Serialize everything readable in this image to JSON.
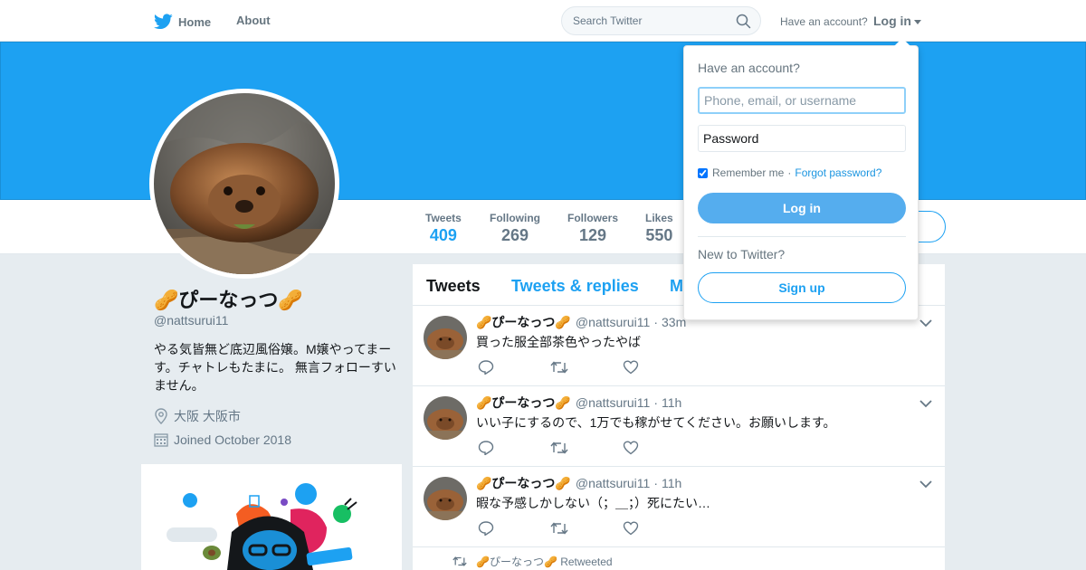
{
  "nav": {
    "home_label": "Home",
    "about_label": "About",
    "search_placeholder": "Search Twitter",
    "have_account": "Have an account?",
    "login_label": "Log in"
  },
  "stats": [
    {
      "label": "Tweets",
      "value": "409"
    },
    {
      "label": "Following",
      "value": "269"
    },
    {
      "label": "Followers",
      "value": "129"
    },
    {
      "label": "Likes",
      "value": "550"
    }
  ],
  "profile": {
    "name": "🥜ぴーなっつ🥜",
    "handle": "@nattsurui11",
    "bio": "やる気皆無ど底辺風俗嬢。M嬢やってまーす。チャトレもたまに。 無言フォローすいません。",
    "location": "大阪 大阪市",
    "joined": "Joined October 2018"
  },
  "timeline": {
    "tabs": [
      "Tweets",
      "Tweets & replies",
      "M"
    ],
    "tweets": [
      {
        "name": "🥜ぴーなっつ🥜",
        "handle": "@nattsurui11",
        "time": "33m",
        "text": "買った服全部茶色やったやば"
      },
      {
        "name": "🥜ぴーなっつ🥜",
        "handle": "@nattsurui11",
        "time": "11h",
        "text": "いい子にするので、1万でも稼がせてください。お願いします。"
      },
      {
        "name": "🥜ぴーなっつ🥜",
        "handle": "@nattsurui11",
        "time": "11h",
        "text": "暇な予感しかしない（；＿；）死にたい…"
      }
    ],
    "retweeted_note": "🥜ぴーなっつ🥜 Retweeted"
  },
  "login_dropdown": {
    "title": "Have an account?",
    "username_placeholder": "Phone, email, or username",
    "password_placeholder": "Password",
    "remember_me": "Remember me",
    "separator": "·",
    "forgot_password": "Forgot password?",
    "login_button": "Log in",
    "new_to_twitter": "New to Twitter?",
    "signup_button": "Sign up"
  },
  "colors": {
    "brand": "#1da1f2",
    "background": "#e6ecf0"
  },
  "icons": [
    "twitter-bird-icon",
    "search-icon",
    "location-pin-icon",
    "calendar-icon",
    "reply-icon",
    "retweet-icon",
    "like-icon",
    "chevron-down-icon"
  ]
}
